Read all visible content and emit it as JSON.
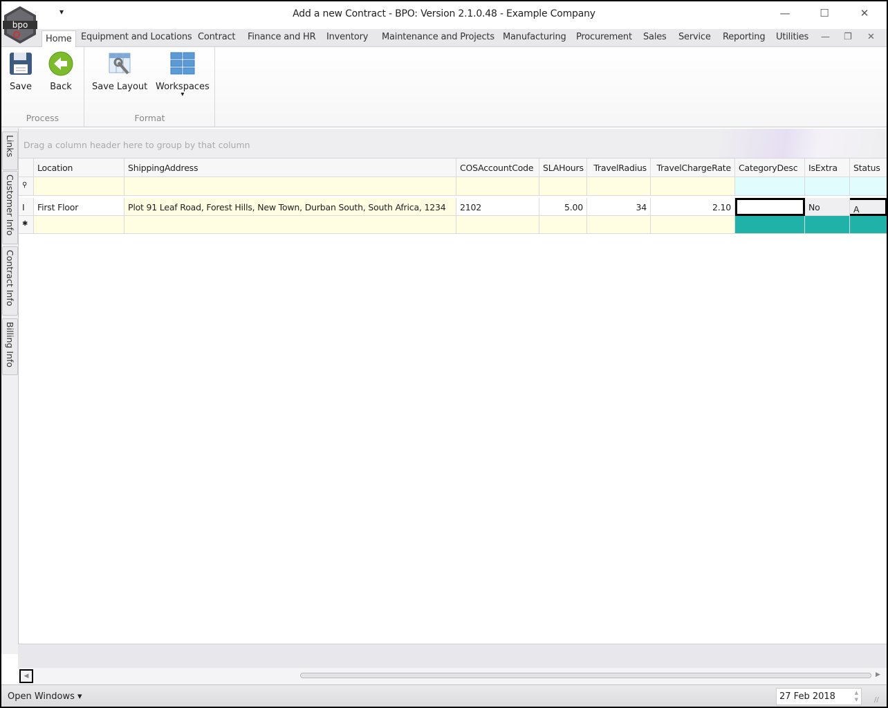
{
  "window": {
    "title": "Add a new Contract - BPO: Version 2.1.0.48 - Example Company",
    "minimize": "—",
    "maximize": "☐",
    "close": "✕"
  },
  "quick_access": "▾",
  "menu_tabs": [
    "Home",
    "Equipment and Locations",
    "Contract",
    "Finance and HR",
    "Inventory",
    "Maintenance and Projects",
    "Manufacturing",
    "Procurement",
    "Sales",
    "Service",
    "Reporting",
    "Utilities"
  ],
  "mdi_controls": {
    "minimize": "—",
    "restore": "❐",
    "close": "✕"
  },
  "ribbon": {
    "groups": [
      {
        "label": "Process",
        "buttons": [
          {
            "label": "Save",
            "icon": "floppy-disk-icon"
          },
          {
            "label": "Back",
            "icon": "back-arrow-icon"
          }
        ]
      },
      {
        "label": "Format",
        "buttons": [
          {
            "label": "Save Layout",
            "icon": "grid-wrench-icon"
          },
          {
            "label": "Workspaces",
            "icon": "workspaces-grid-icon",
            "dropdown": "▾"
          }
        ]
      }
    ]
  },
  "side_tabs": [
    "Links",
    "Customer Info",
    "Contract Info",
    "Billing Info"
  ],
  "grid": {
    "group_hint": "Drag a column header here to group by that column",
    "columns": [
      "Location",
      "ShippingAddress",
      "COSAccountCode",
      "SLAHours",
      "TravelRadius",
      "TravelChargeRate",
      "CategoryDesc",
      "IsExtra",
      "Status"
    ],
    "filter_icon": "⚲",
    "edit_icon": "I",
    "new_row_icon": "✱",
    "rows": [
      [
        "First Floor",
        "Plot 91 Leaf Road, Forest Hills, New Town, Durban South, South Africa, 1234",
        "2102",
        "5.00",
        "34",
        "2.10",
        "",
        "No",
        "A"
      ]
    ],
    "colors": {
      "editable": "#fffde2",
      "readonly_filter": "#e0fcfc",
      "new_row_readonly": "#20b2a8",
      "readonly_cell": "#efeff1"
    }
  },
  "statusbar": {
    "open_windows": "Open Windows ▾",
    "date": "27 Feb 2018"
  }
}
